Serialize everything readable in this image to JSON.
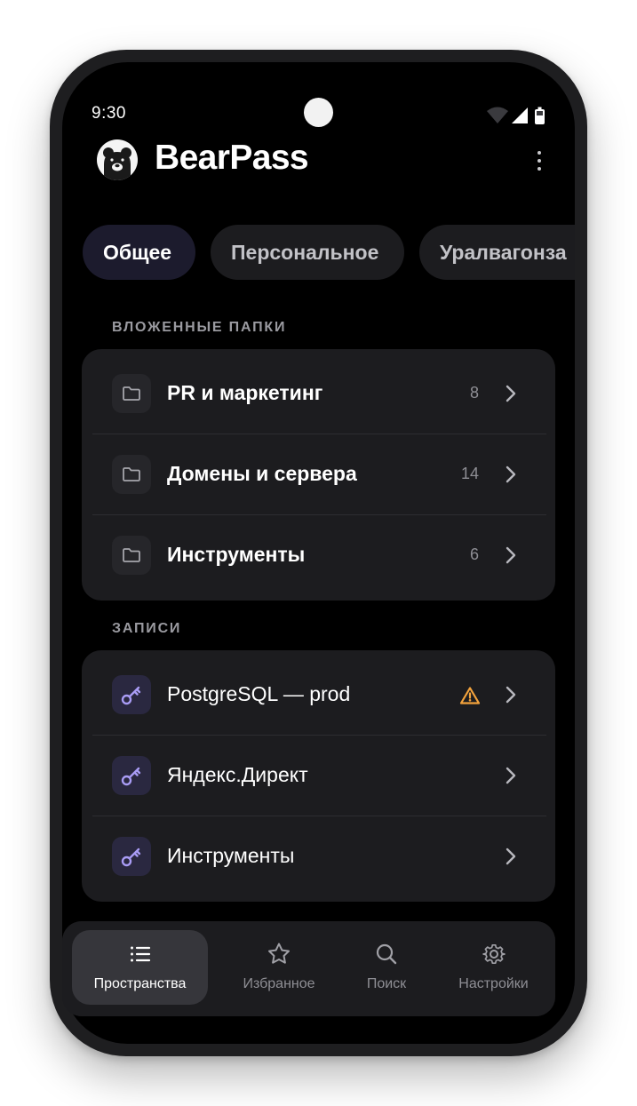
{
  "status_bar": {
    "time": "9:30"
  },
  "app": {
    "title": "BearPass"
  },
  "tabs": [
    {
      "label": "Общее",
      "active": true
    },
    {
      "label": "Персональное",
      "active": false
    },
    {
      "label": "Уралвагонза",
      "active": false
    }
  ],
  "folders": {
    "title": "ВЛОЖЕННЫЕ ПАПКИ",
    "items": [
      {
        "label": "PR и маркетинг",
        "count": "8",
        "icon": "folder-icon"
      },
      {
        "label": "Домены и сервера",
        "count": "14",
        "icon": "folder-icon"
      },
      {
        "label": "Инструменты",
        "count": "6",
        "icon": "folder-icon"
      }
    ]
  },
  "records": {
    "title": "ЗАПИСИ",
    "items": [
      {
        "label": "PostgreSQL — prod",
        "icon": "key-icon",
        "warning": true
      },
      {
        "label": "Яндекс.Директ",
        "icon": "key-icon",
        "warning": false
      },
      {
        "label": "Инструменты",
        "icon": "key-icon",
        "warning": false
      }
    ]
  },
  "nav": {
    "items": [
      {
        "label": "Пространства",
        "icon": "list-icon",
        "active": true
      },
      {
        "label": "Избранное",
        "icon": "star-icon",
        "active": false
      },
      {
        "label": "Поиск",
        "icon": "search-icon",
        "active": false
      },
      {
        "label": "Настройки",
        "icon": "gear-icon",
        "active": false
      }
    ]
  },
  "colors": {
    "background": "#000000",
    "card": "#1c1c1f",
    "accent_key": "#a99cf5",
    "warning": "#f2a23c",
    "active_tab": "#1c1b2d"
  }
}
